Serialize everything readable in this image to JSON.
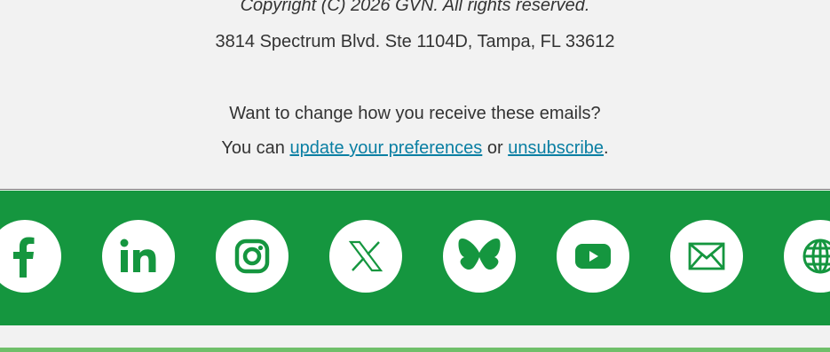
{
  "footer": {
    "copyright": "Copyright (C) 2026 GVN. All rights reserved.",
    "address": "3814 Spectrum Blvd. Ste 1104D, Tampa, FL 33612",
    "change_prompt": "Want to change how you receive these emails?",
    "pref_prefix": "You can ",
    "pref_link": "update your preferences",
    "pref_middle": " or ",
    "unsub_link": "unsubscribe",
    "pref_suffix": "."
  },
  "social": {
    "icons": [
      {
        "name": "facebook-icon"
      },
      {
        "name": "linkedin-icon"
      },
      {
        "name": "instagram-icon"
      },
      {
        "name": "x-icon"
      },
      {
        "name": "bluesky-icon"
      },
      {
        "name": "youtube-icon"
      },
      {
        "name": "email-icon"
      },
      {
        "name": "globe-icon"
      }
    ]
  },
  "colors": {
    "social_bar": "#15963f",
    "link": "#0a7fa3",
    "bottom_stripe": "#6fbf6a",
    "background": "#f2f2f2"
  }
}
